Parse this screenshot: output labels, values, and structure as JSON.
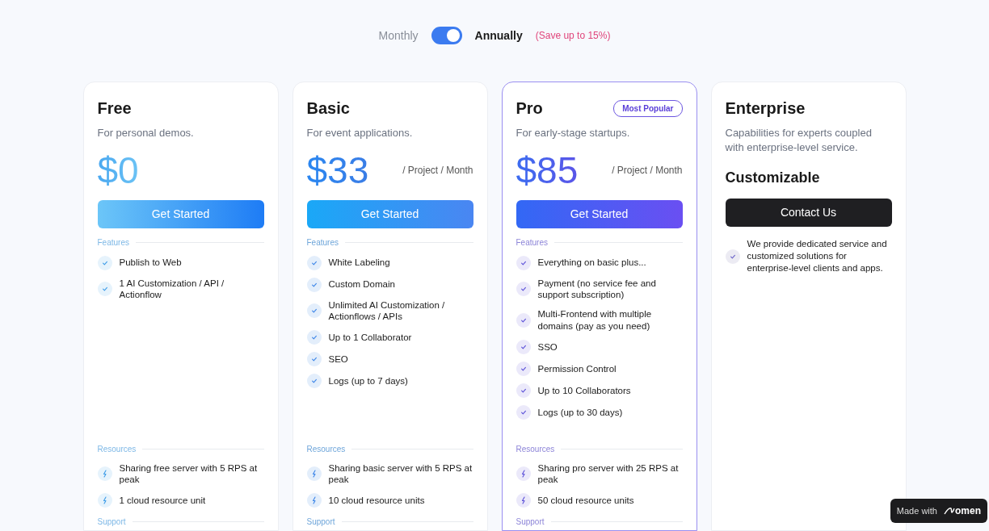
{
  "billing_toggle": {
    "monthly_label": "Monthly",
    "annual_label": "Annually",
    "annual": true,
    "save_note": "(Save up to 15%)"
  },
  "plans": [
    {
      "kind": "free",
      "name": "Free",
      "featured": false,
      "subtitle": "For personal demos.",
      "price": "$0",
      "button": "Get Started",
      "sections": [
        {
          "title": "Features",
          "kind": "checklist",
          "items": [
            "Publish to Web",
            "1 AI Customization / API / Actionflow"
          ]
        },
        {
          "title": "Resources",
          "kind": "resources",
          "items": [
            "Sharing free server with 5 RPS at peak",
            "1 cloud resource unit"
          ]
        },
        {
          "title": "Support"
        }
      ]
    },
    {
      "kind": "basic",
      "name": "Basic",
      "featured": false,
      "subtitle": "For event applications.",
      "price": "$33",
      "period": "/ Project / Month",
      "button": "Get Started",
      "sections": [
        {
          "title": "Features",
          "kind": "checklist",
          "items": [
            "White Labeling",
            "Custom Domain",
            "Unlimited AI Customization / Actionflows / APIs",
            "Up to 1 Collaborator",
            "SEO",
            "Logs (up to 7 days)"
          ]
        },
        {
          "title": "Resources",
          "kind": "resources",
          "items": [
            "Sharing basic server with 5 RPS at peak",
            "10  cloud resource units"
          ]
        },
        {
          "title": "Support"
        }
      ]
    },
    {
      "kind": "pro",
      "name": "Pro",
      "featured": true,
      "badge": "Most Popular",
      "subtitle": "For early-stage startups.",
      "price": "$85",
      "period": "/ Project / Month",
      "button": "Get Started",
      "sections": [
        {
          "title": "Features",
          "kind": "checklist",
          "items": [
            "Everything on basic plus...",
            "Payment (no service fee and support subscription)",
            "Multi-Frontend with multiple domains (pay as you need)",
            "SSO",
            "Permission Control",
            "Up to 10 Collaborators",
            "Logs (up to 30 days)"
          ]
        },
        {
          "title": "Resources",
          "kind": "resources",
          "items": [
            "Sharing pro server with 25 RPS at peak",
            "50  cloud resource units"
          ]
        },
        {
          "title": "Support"
        }
      ]
    },
    {
      "kind": "enterprise",
      "name": "Enterprise",
      "featured": false,
      "subtitle": "Capabilities for experts coupled with enterprise-level service.",
      "price_label": "Customizable",
      "button": "Contact Us",
      "sections": [
        {
          "kind": "checklist",
          "items": [
            "We provide dedicated service and customized solutions for enterprise-level clients and apps."
          ]
        }
      ]
    }
  ],
  "made_with": {
    "label": "Made with",
    "brand": "omen"
  }
}
